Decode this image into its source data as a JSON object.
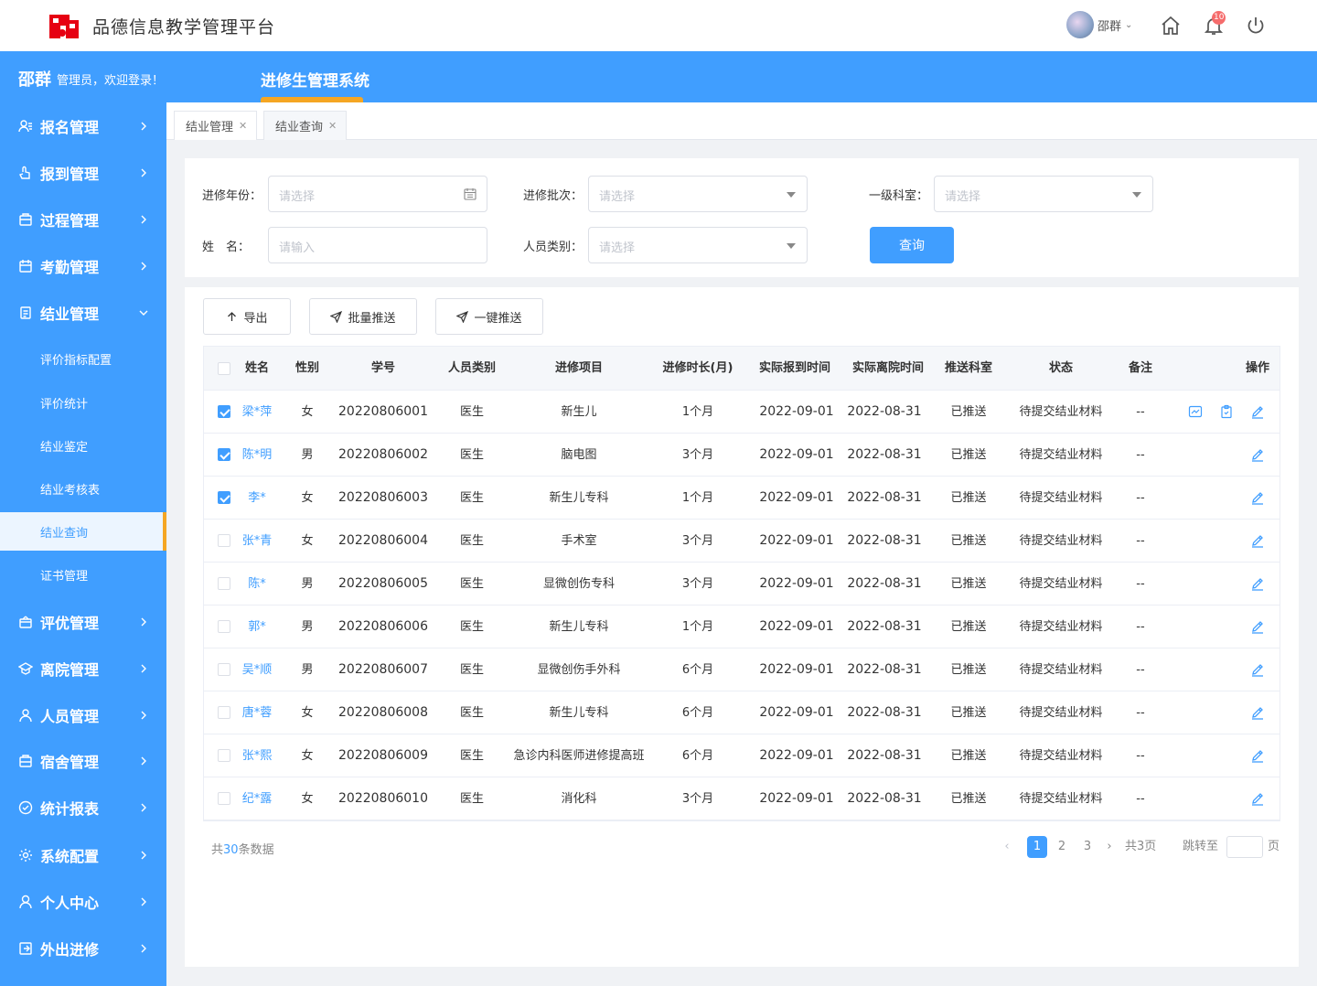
{
  "header": {
    "app_title": "品德信息教学管理平台",
    "user_name": "邵群",
    "notification_count": "10"
  },
  "bluebar": {
    "welcome_name": "邵群",
    "welcome_text": "管理员，欢迎登录！",
    "system_title": "进修生管理系统"
  },
  "sidebar": {
    "items": [
      {
        "label": "报名管理",
        "icon": "register-icon"
      },
      {
        "label": "报到管理",
        "icon": "checkin-icon"
      },
      {
        "label": "过程管理",
        "icon": "process-icon"
      },
      {
        "label": "考勤管理",
        "icon": "calendar-icon"
      },
      {
        "label": "结业管理",
        "icon": "document-icon"
      },
      {
        "label": "评优管理",
        "icon": "award-icon"
      },
      {
        "label": "离院管理",
        "icon": "leave-icon"
      },
      {
        "label": "人员管理",
        "icon": "user-icon"
      },
      {
        "label": "宿舍管理",
        "icon": "dorm-icon"
      },
      {
        "label": "统计报表",
        "icon": "chart-icon"
      },
      {
        "label": "系统配置",
        "icon": "settings-icon"
      },
      {
        "label": "个人中心",
        "icon": "person-icon"
      },
      {
        "label": "外出进修",
        "icon": "exit-icon"
      }
    ],
    "sub_items": [
      "评价指标配置",
      "评价统计",
      "结业鉴定",
      "结业考核表",
      "结业查询",
      "证书管理"
    ]
  },
  "tabs": [
    {
      "label": "结业管理"
    },
    {
      "label": "结业查询"
    }
  ],
  "filters": {
    "year_label": "进修年份：",
    "year_placeholder": "请选择",
    "batch_label": "进修批次：",
    "batch_placeholder": "请选择",
    "dept_label": "一级科室：",
    "dept_placeholder": "请选择",
    "name_label": "姓　名：",
    "name_placeholder": "请输入",
    "category_label": "人员类别：",
    "category_placeholder": "请选择",
    "query_button": "查询"
  },
  "actions": {
    "export": "导出",
    "batch_push": "批量推送",
    "one_click_push": "一键推送"
  },
  "table": {
    "columns": [
      "姓名",
      "性别",
      "学号",
      "人员类别",
      "进修项目",
      "进修时长(月)",
      "实际报到时间",
      "实际离院时间",
      "推送科室",
      "状态",
      "备注",
      "操作"
    ],
    "rows": [
      {
        "checked": true,
        "name": "梁*萍",
        "gender": "女",
        "id": "20220806001",
        "category": "医生",
        "project": "新生儿",
        "duration": "1个月",
        "arrive": "2022-09-01",
        "leave": "2022-08-31",
        "push": "已推送",
        "status": "待提交结业材料",
        "remark": "--",
        "extra_ops": true
      },
      {
        "checked": true,
        "name": "陈*明",
        "gender": "男",
        "id": "20220806002",
        "category": "医生",
        "project": "脑电图",
        "duration": "3个月",
        "arrive": "2022-09-01",
        "leave": "2022-08-31",
        "push": "已推送",
        "status": "待提交结业材料",
        "remark": "--",
        "extra_ops": false
      },
      {
        "checked": true,
        "name": "李*",
        "gender": "女",
        "id": "20220806003",
        "category": "医生",
        "project": "新生儿专科",
        "duration": "1个月",
        "arrive": "2022-09-01",
        "leave": "2022-08-31",
        "push": "已推送",
        "status": "待提交结业材料",
        "remark": "--",
        "extra_ops": false
      },
      {
        "checked": false,
        "name": "张*青",
        "gender": "女",
        "id": "20220806004",
        "category": "医生",
        "project": "手术室",
        "duration": "3个月",
        "arrive": "2022-09-01",
        "leave": "2022-08-31",
        "push": "已推送",
        "status": "待提交结业材料",
        "remark": "--",
        "extra_ops": false
      },
      {
        "checked": false,
        "name": "陈*",
        "gender": "男",
        "id": "20220806005",
        "category": "医生",
        "project": "显微创伤专科",
        "duration": "3个月",
        "arrive": "2022-09-01",
        "leave": "2022-08-31",
        "push": "已推送",
        "status": "待提交结业材料",
        "remark": "--",
        "extra_ops": false
      },
      {
        "checked": false,
        "name": "郭*",
        "gender": "男",
        "id": "20220806006",
        "category": "医生",
        "project": "新生儿专科",
        "duration": "1个月",
        "arrive": "2022-09-01",
        "leave": "2022-08-31",
        "push": "已推送",
        "status": "待提交结业材料",
        "remark": "--",
        "extra_ops": false
      },
      {
        "checked": false,
        "name": "吴*顺",
        "gender": "男",
        "id": "20220806007",
        "category": "医生",
        "project": "显微创伤手外科",
        "duration": "6个月",
        "arrive": "2022-09-01",
        "leave": "2022-08-31",
        "push": "已推送",
        "status": "待提交结业材料",
        "remark": "--",
        "extra_ops": false
      },
      {
        "checked": false,
        "name": "唐*蓉",
        "gender": "女",
        "id": "20220806008",
        "category": "医生",
        "project": "新生儿专科",
        "duration": "6个月",
        "arrive": "2022-09-01",
        "leave": "2022-08-31",
        "push": "已推送",
        "status": "待提交结业材料",
        "remark": "--",
        "extra_ops": false
      },
      {
        "checked": false,
        "name": "张*熙",
        "gender": "女",
        "id": "20220806009",
        "category": "医生",
        "project": "急诊内科医师进修提高班",
        "duration": "6个月",
        "arrive": "2022-09-01",
        "leave": "2022-08-31",
        "push": "已推送",
        "status": "待提交结业材料",
        "remark": "--",
        "extra_ops": false
      },
      {
        "checked": false,
        "name": "纪*露",
        "gender": "女",
        "id": "20220806010",
        "category": "医生",
        "project": "消化科",
        "duration": "3个月",
        "arrive": "2022-09-01",
        "leave": "2022-08-31",
        "push": "已推送",
        "status": "待提交结业材料",
        "remark": "--",
        "extra_ops": false
      }
    ]
  },
  "pagination": {
    "total_prefix": "共",
    "total_count": "30",
    "total_suffix": "条数据",
    "pages": [
      "1",
      "2",
      "3"
    ],
    "current": "1",
    "page_count": "共3页",
    "jump_label": "跳转至",
    "page_suffix": "页"
  },
  "colors": {
    "primary": "#409eff",
    "accent": "#f5a623",
    "badge": "#f56c6c"
  }
}
